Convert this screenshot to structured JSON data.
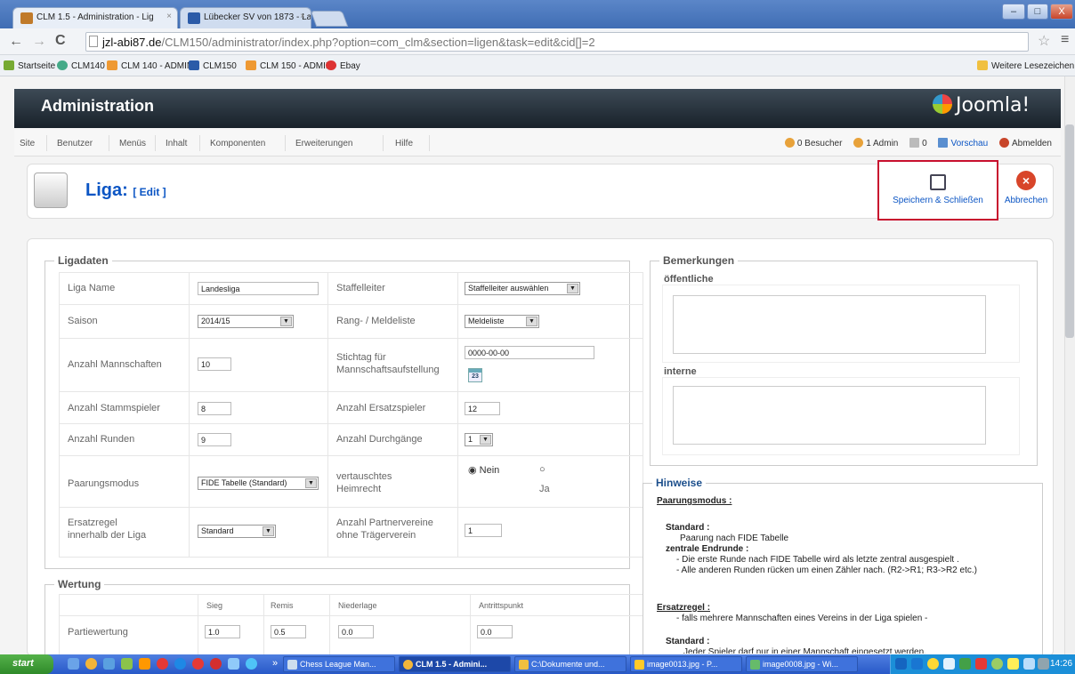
{
  "browser": {
    "tabs": [
      {
        "label": "CLM 1.5 - Administration - Lig",
        "active": true
      },
      {
        "label": "Lübecker SV von 1873 - Landı",
        "active": false
      }
    ],
    "url_host": "jzl-abi87.de",
    "url_path": "/CLM150/administrator/index.php?option=com_clm&section=ligen&task=edit&cid[]=2",
    "bookmarks": [
      "Startseite",
      "CLM140",
      "CLM 140 - ADMIN",
      "CLM150",
      "CLM 150 - ADMIN",
      "Ebay"
    ],
    "other_bookmarks": "Weitere Lesezeichen",
    "window_buttons": [
      "–",
      "□",
      "X"
    ]
  },
  "admin": {
    "title": "Administration",
    "brand": "Joomla!",
    "menu": [
      "Site",
      "Benutzer",
      "Menüs",
      "Inhalt",
      "Komponenten",
      "Erweiterungen",
      "Hilfe"
    ],
    "status": {
      "visitors": "0 Besucher",
      "admins": "1 Admin",
      "messages": "0",
      "preview": "Vorschau",
      "logout": "Abmelden"
    }
  },
  "toolbar": {
    "page_title": "Liga:",
    "page_sub": "[ Edit ]",
    "save_label": "Speichern & Schließen",
    "cancel_label": "Abbrechen"
  },
  "ligadaten": {
    "legend": "Ligadaten",
    "liga_name_label": "Liga Name",
    "liga_name_value": "Landesliga",
    "staffelleiter_label": "Staffelleiter",
    "staffelleiter_value": "Staffelleiter auswählen",
    "saison_label": "Saison",
    "saison_value": "2014/15",
    "rang_label": "Rang- / Meldeliste",
    "rang_value": "Meldeliste",
    "anzahl_mannschaften_label": "Anzahl Mannschaften",
    "anzahl_mannschaften_value": "10",
    "stichtag_label_1": "Stichtag für",
    "stichtag_label_2": "Mannschaftsaufstellung",
    "stichtag_value": "0000-00-00",
    "calendar_day": "23",
    "stammspieler_label": "Anzahl Stammspieler",
    "stammspieler_value": "8",
    "ersatzspieler_label": "Anzahl Ersatzspieler",
    "ersatzspieler_value": "12",
    "runden_label": "Anzahl Runden",
    "runden_value": "9",
    "durchgaenge_label": "Anzahl Durchgänge",
    "durchgaenge_value": "1",
    "paarungsmodus_label": "Paarungsmodus",
    "paarungsmodus_value": "FIDE Tabelle (Standard)",
    "heimrecht_label_1": "vertauschtes",
    "heimrecht_label_2": "Heimrecht",
    "heimrecht_nein": "Nein",
    "heimrecht_ja": "Ja",
    "ersatzregel_label_1": "Ersatzregel",
    "ersatzregel_label_2": "innerhalb der Liga",
    "ersatzregel_value": "Standard",
    "partnervereine_label_1": "Anzahl Partnervereine",
    "partnervereine_label_2": "ohne Trägerverein",
    "partnervereine_value": "1"
  },
  "wertung": {
    "legend": "Wertung",
    "headers": [
      "Sieg",
      "Remis",
      "Niederlage",
      "Antrittspunkt"
    ],
    "row_label": "Partiewertung",
    "values": [
      "1.0",
      "0.5",
      "0.0",
      "0.0"
    ]
  },
  "bemerkungen": {
    "legend": "Bemerkungen",
    "public_label": "öffentliche",
    "internal_label": "interne"
  },
  "hinweise": {
    "legend": "Hinweise",
    "lines": [
      "Paarungsmodus :",
      "Standard :",
      "Paarung nach FIDE Tabelle",
      "zentrale Endrunde :",
      "- Die erste Runde nach FIDE Tabelle wird als letzte zentral ausgespielt .",
      "- Alle anderen Runden rücken um einen Zähler nach. (R2->R1; R3->R2 etc.)",
      "Ersatzregel :",
      "- falls mehrere Mannschaften eines Vereins in der Liga spielen -",
      "Standard :",
      "Jeder Spieler darf nur in einer Mannschaft eingesetzt werden."
    ]
  },
  "taskbar": {
    "start": "start",
    "chevron": "»",
    "tasks": [
      "Chess League Man...",
      "CLM 1.5 - Admini...",
      "C:\\Dokumente und...",
      "image0013.jpg - P...",
      "image0008.jpg - Wi..."
    ],
    "clock": "14:26"
  }
}
